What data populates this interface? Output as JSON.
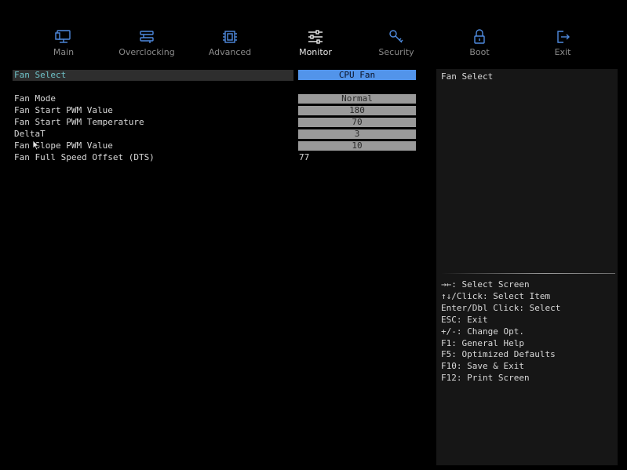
{
  "nav": {
    "tabs": [
      {
        "label": "Main",
        "icon": "monitor-icon"
      },
      {
        "label": "Overclocking",
        "icon": "overclock-icon"
      },
      {
        "label": "Advanced",
        "icon": "chip-icon"
      },
      {
        "label": "Monitor",
        "icon": "sliders-icon",
        "active": true
      },
      {
        "label": "Security",
        "icon": "key-icon"
      },
      {
        "label": "Boot",
        "icon": "lock-icon"
      },
      {
        "label": "Exit",
        "icon": "exit-icon"
      }
    ]
  },
  "settings": {
    "fan_select": {
      "label": "Fan Select",
      "value": "CPU Fan"
    },
    "fan_mode": {
      "label": "Fan Mode",
      "value": "Normal"
    },
    "fan_start_pwm_value": {
      "label": "Fan Start PWM Value",
      "value": "180"
    },
    "fan_start_pwm_temperature": {
      "label": "Fan Start PWM Temperature",
      "value": "70"
    },
    "deltat": {
      "label": "DeltaT",
      "value": "3"
    },
    "fan_slope_pwm_value": {
      "label": "Fan Slope PWM Value",
      "value": "10"
    },
    "fan_full_speed_offset": {
      "label": "Fan Full Speed Offset (DTS)",
      "value": "77"
    }
  },
  "help": {
    "title": "Fan Select",
    "keys": [
      "→←: Select Screen",
      "↑↓/Click: Select Item",
      "Enter/Dbl Click: Select",
      "ESC: Exit",
      "+/-: Change Opt.",
      "F1: General Help",
      "F5: Optimized Defaults",
      "F10: Save & Exit",
      "F12: Print Screen"
    ]
  },
  "colors": {
    "accent": "#5294ea",
    "highlight_text": "#6fc2c8",
    "icon_blue": "#4f8be0",
    "value_box": "#9a9a9a"
  }
}
